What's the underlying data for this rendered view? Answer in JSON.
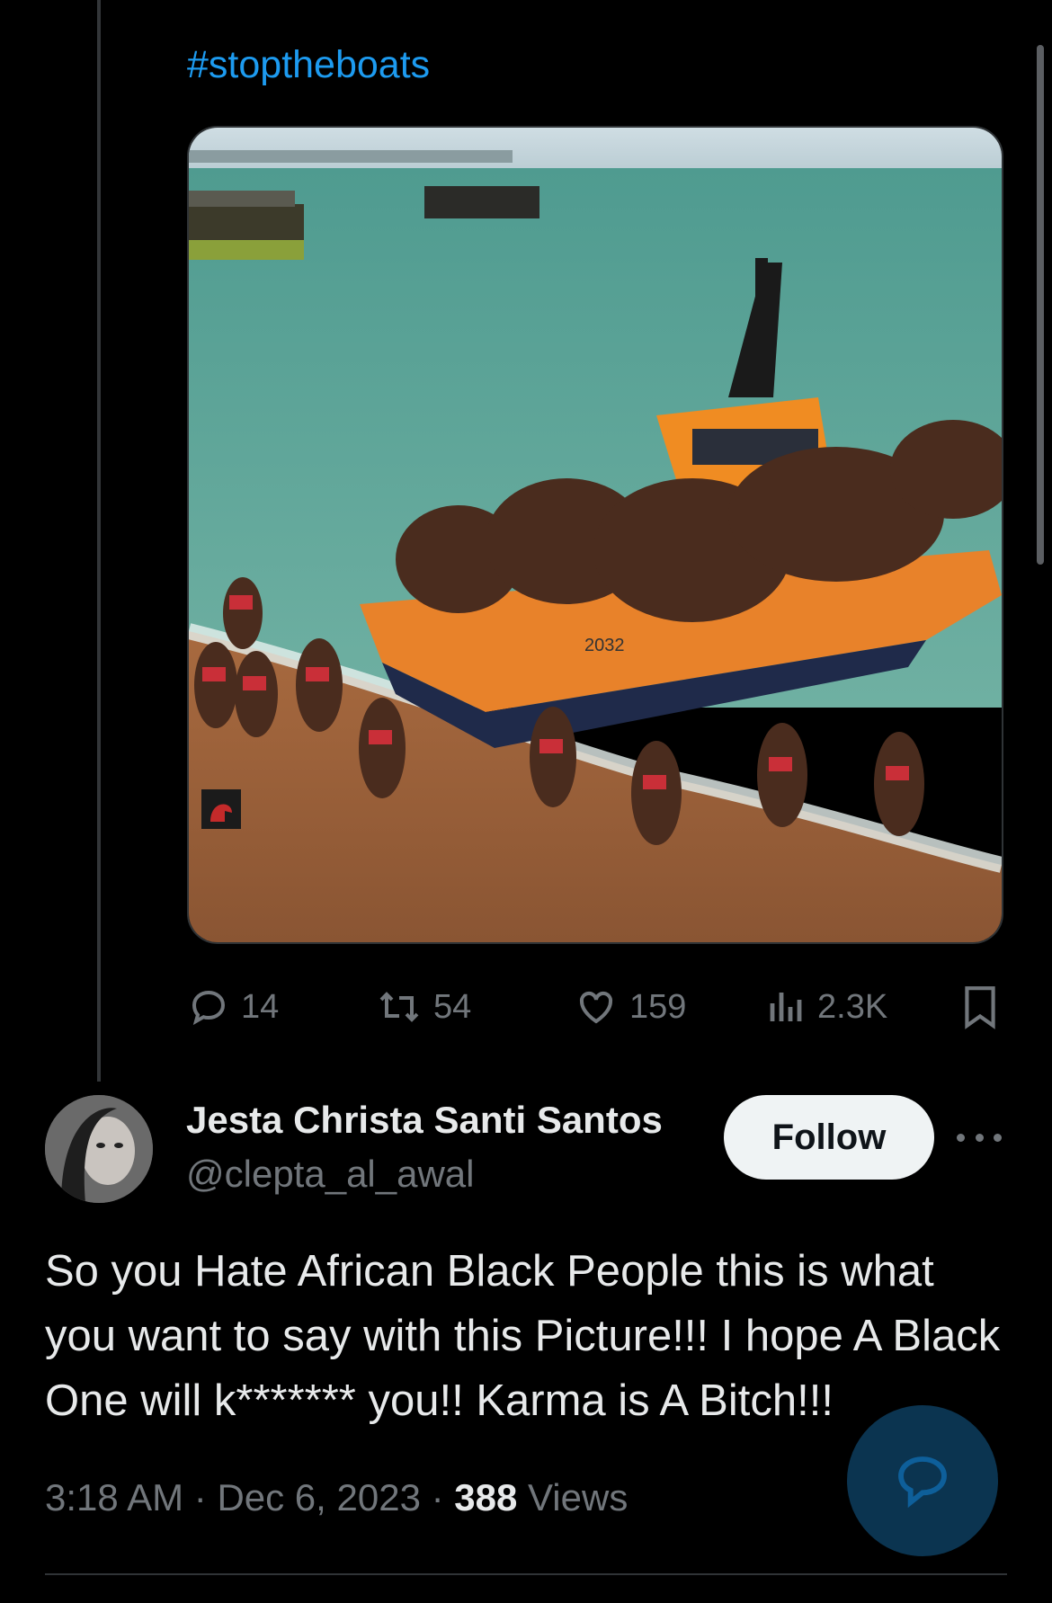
{
  "post": {
    "hashtag": "#stoptheboats",
    "media_image": "ai-generated-image-beach-lifeboat",
    "media_boat_label": "2032",
    "stats": {
      "replies": "14",
      "reposts": "54",
      "likes": "159",
      "views": "2.3K"
    }
  },
  "reply": {
    "display_name": "Jesta Christa Santi Santos",
    "handle": "@clepta_al_awal",
    "follow_label": "Follow",
    "text": "So you Hate African Black People this is what you want to say with this Picture!!! I hope A Black One will k******* you!! Karma is A Bitch!!!",
    "time": "3:18 AM",
    "date": "Dec 6, 2023",
    "separator": "·",
    "views_count": "388",
    "views_label": "Views"
  },
  "icons": {
    "reply": "reply-icon",
    "repost": "repost-icon",
    "like": "like-icon",
    "views": "views-icon",
    "bookmark": "bookmark-icon",
    "more": "more-icon",
    "compose": "compose-reply-icon"
  },
  "colors": {
    "background": "#000000",
    "accent": "#1d9bf0",
    "secondary_text": "#71767b",
    "primary_text": "#e7e9ea",
    "follow_button": "#eff3f4",
    "fab": "#0b3450"
  }
}
